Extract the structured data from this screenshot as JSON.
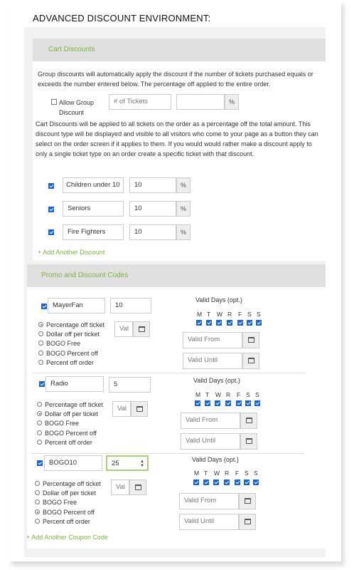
{
  "title": "ADVANCED DISCOUNT ENVIRONMENT:",
  "cart": {
    "header": "Cart Discounts",
    "group_text": "Group discounts will automatically apply the discount if the number of tickets purchased equals or exceeds the number entered below. The percentage off applied to the entire order.",
    "allow_group_label": "Allow Group Discount",
    "allow_group_checked": false,
    "tickets_placeholder": "# of Tickets",
    "percent_symbol": "%",
    "cart_text": "Cart Discounts will be applied to all tickets on the order as a percentage off the total amount. This discount type will be displayed and visible to all visitors who come to your page as a button they can select on the order screen if it applies to them. If you would would rather make a discount apply to only a single ticket type on an order create a specific ticket with that discount.",
    "items": [
      {
        "checked": true,
        "name": "Children under 10",
        "value": "10"
      },
      {
        "checked": true,
        "name": "Seniors",
        "value": "10"
      },
      {
        "checked": true,
        "name": "Fire Fighters",
        "value": "10"
      }
    ],
    "add_label": "+ Add Another Discount"
  },
  "promo": {
    "header": "Promo and Discount Codes",
    "valid_days_label": "Valid Days (opt.)",
    "days": [
      "M",
      "T",
      "W",
      "R",
      "F",
      "S",
      "S"
    ],
    "type_options": [
      "Percentage off ticket",
      "Dollar off per ticket",
      "BOGO Free",
      "BOGO Percent off",
      "Percent off order"
    ],
    "value_placeholder": "Val",
    "valid_from_placeholder": "Valid From",
    "valid_until_placeholder": "Valid Until",
    "codes": [
      {
        "checked": true,
        "code": "MayerFan",
        "amount": "10",
        "selected_type": 0,
        "days_checked": [
          true,
          true,
          true,
          true,
          true,
          true,
          true
        ]
      },
      {
        "checked": true,
        "code": "Radio",
        "amount": "5",
        "selected_type": 1,
        "days_checked": [
          true,
          true,
          true,
          true,
          true,
          true,
          true
        ]
      },
      {
        "checked": true,
        "code": "BOGO10",
        "amount": "25",
        "selected_type": 3,
        "days_checked": [
          true,
          true,
          true,
          true,
          true,
          true,
          true
        ]
      }
    ],
    "add_label": "+ Add Another Coupon Code"
  }
}
